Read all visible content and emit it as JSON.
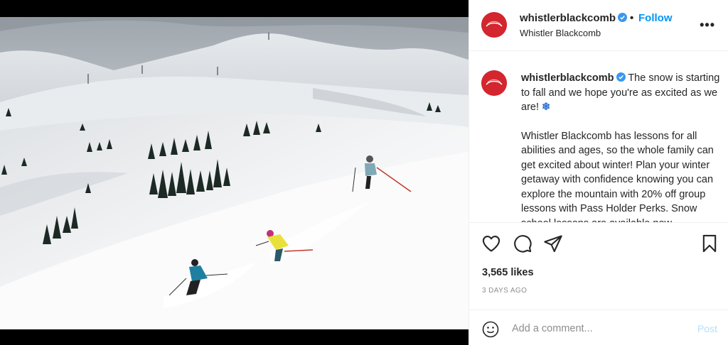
{
  "post": {
    "username": "whistlerblackcomb",
    "separator": "•",
    "follow_label": "Follow",
    "location": "Whistler Blackcomb",
    "more_label": "•••",
    "caption_intro": "The snow is starting to fall and we hope you're as excited as we are!",
    "caption_emoji": "❄",
    "caption_body": "Whistler Blackcomb has lessons for all abilities and ages, so the whole family can get excited about winter! Plan your winter getaway with confidence knowing you can explore the mountain with 20% off group lessons with Pass Holder Perks. Snow school lessons are available now.",
    "likes": "3,565 likes",
    "date": "3 DAYS AGO"
  },
  "comment": {
    "placeholder": "Add a comment...",
    "post_label": "Post"
  },
  "icons": {
    "like": "heart-icon",
    "comment": "comment-icon",
    "share": "paper-plane-icon",
    "save": "bookmark-icon",
    "emoji": "smiley-icon",
    "verified": "verified-badge-icon"
  },
  "colors": {
    "follow": "#0095f6",
    "post_disabled": "#b2dffc",
    "avatar": "#d3262e",
    "verified": "#3897f0"
  }
}
